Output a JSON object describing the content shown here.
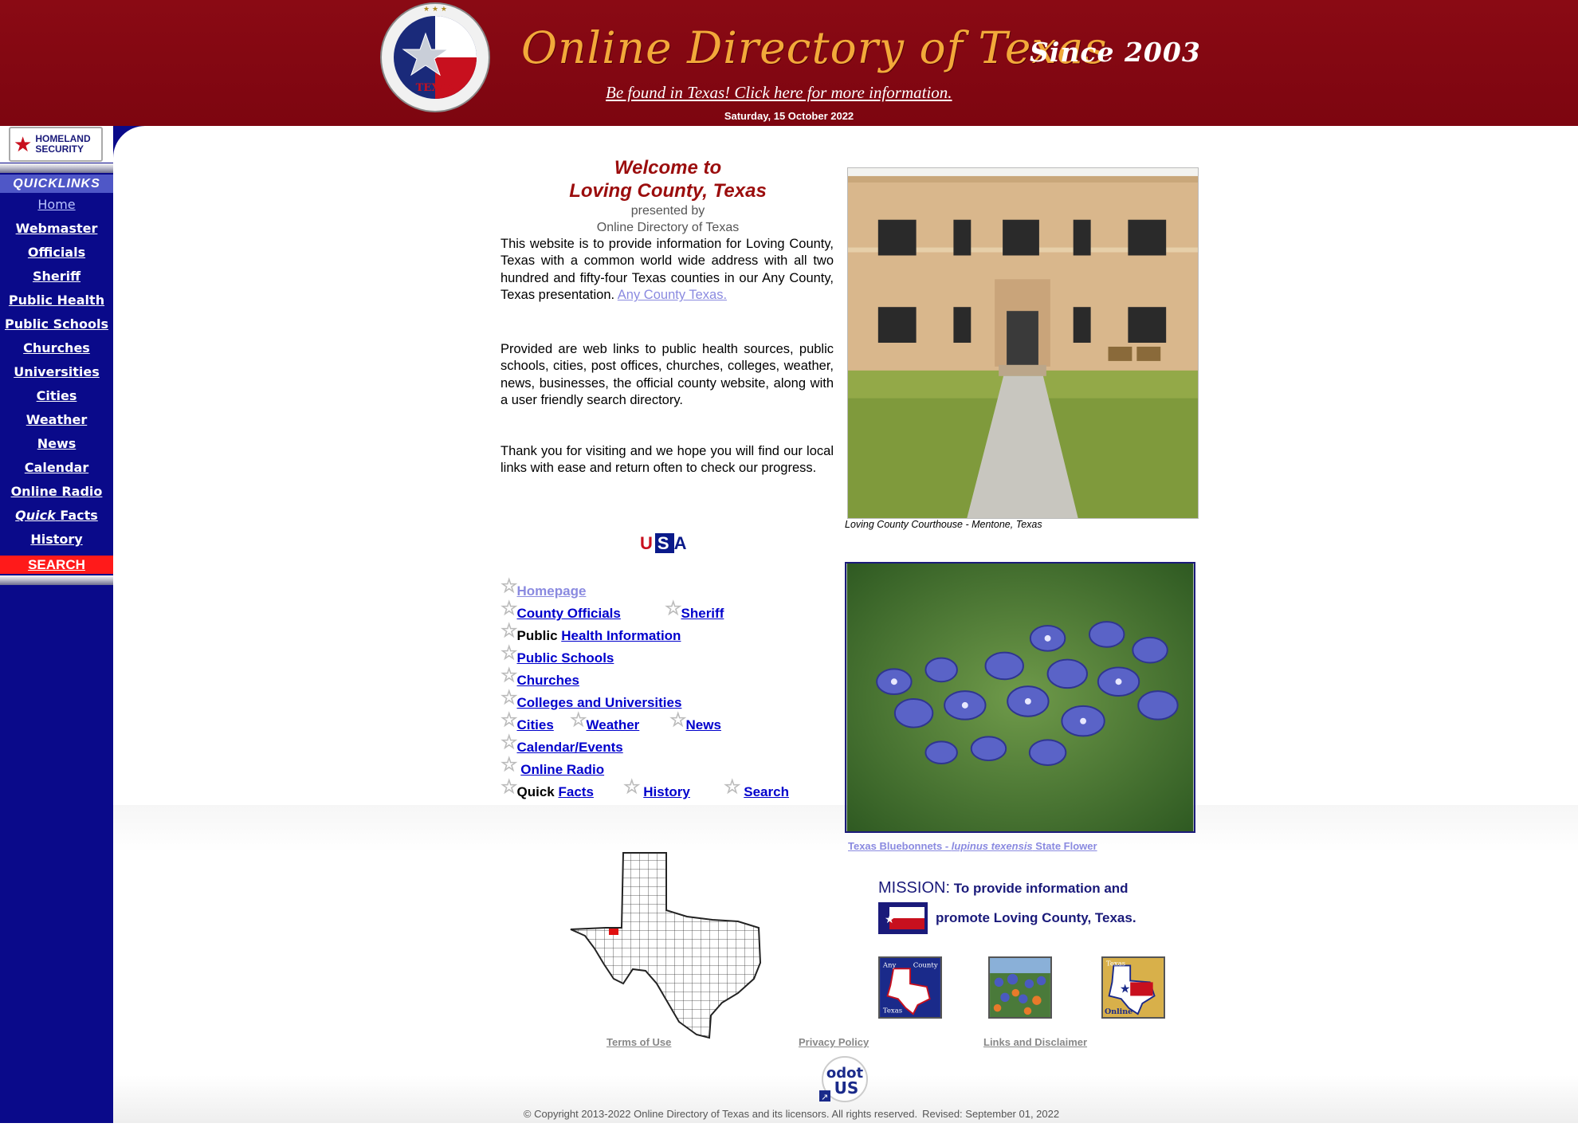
{
  "header": {
    "site_title": "Online Directory of Texas",
    "since": "Since 2003",
    "promo_text": "Be found in Texas!  Click here for more information.",
    "date": "Saturday, 15 October 2022",
    "seal_text": "ONLINE DIRECTORY TEXAS ODOT.US",
    "colors": {
      "banner": "#8a0a14",
      "title": "#f2a93a"
    }
  },
  "sidebar": {
    "homeland_label_line1": "HOMELAND",
    "homeland_label_line2": "SECURITY",
    "quicklinks_header": "QUICKLINKS",
    "items": [
      {
        "label": "Home"
      },
      {
        "label": "Webmaster"
      },
      {
        "label": "Officials"
      },
      {
        "label": "Sheriff"
      },
      {
        "label": "Public Health"
      },
      {
        "label": "Public Schools"
      },
      {
        "label": "Churches"
      },
      {
        "label": "Universities"
      },
      {
        "label": "Cities"
      },
      {
        "label": "Weather"
      },
      {
        "label": "News"
      },
      {
        "label": "Calendar"
      },
      {
        "label": "Online Radio"
      },
      {
        "label_italic": "Quick",
        "label": "Facts"
      },
      {
        "label": "History"
      }
    ],
    "search_label": "SEARCH",
    "colors": {
      "background": "#0a0a8a",
      "search": "#ff1a1a"
    }
  },
  "welcome": {
    "line1": "Welcome to",
    "line2": "Loving County, Texas",
    "line3": "presented by",
    "line4": "Online Directory of Texas"
  },
  "paragraphs": {
    "p1": "This website is to provide information for Loving County, Texas with a common world wide address with all two hundred and fifty-four Texas counties in our Any County, Texas presentation.",
    "p1_link": "Any County Texas.",
    "p2": "Provided are web links to public health sources, public schools, cities, post offices, churches, colleges, weather, news, businesses, the official county website, along with a user friendly search directory.",
    "p3": "Thank you for visiting and we hope you will find our local links with ease and return often to check our progress."
  },
  "usa_badge": {
    "u": "U",
    "s": "S",
    "a": "A"
  },
  "links": {
    "homepage": "Homepage",
    "county_officials": "County Officials",
    "sheriff": "Sheriff",
    "public_prefix": "Public",
    "health_information": "Health Information",
    "public_schools": "Public Schools",
    "churches": "Churches",
    "colleges": "Colleges and Universities",
    "cities": "Cities",
    "weather": "Weather",
    "news": "News",
    "calendar": "Calendar/Events",
    "online_radio": "Online Radio",
    "quick_prefix": "Quick",
    "facts": "Facts",
    "history": "History",
    "search": "Search"
  },
  "photos": {
    "courthouse_caption": "Loving County Courthouse - Mentone, Texas",
    "bluebonnet_caption_a": "Texas Bluebonnets - ",
    "bluebonnet_caption_b": "lupinus texensis",
    "bluebonnet_caption_c": "  State Flower"
  },
  "mission": {
    "label": "MISSION:",
    "text1": "To provide information and",
    "text2": "promote Loving County, Texas."
  },
  "thumbnails": {
    "any_county_line1": "Any",
    "any_county_line2": "County",
    "any_county_line3": "Texas",
    "texas_online_line1": "Texas",
    "texas_online_line2": "Online"
  },
  "footer": {
    "terms": "Terms of Use",
    "privacy": "Privacy Policy",
    "links_disclaimer": "Links and Disclaimer",
    "odot_line1": "odot",
    "odot_line2": "US",
    "copyright": "© Copyright 2013-2022 Online Directory of  Texas and its licensors. All rights reserved.",
    "revised": "Revised: September 01, 2022"
  }
}
